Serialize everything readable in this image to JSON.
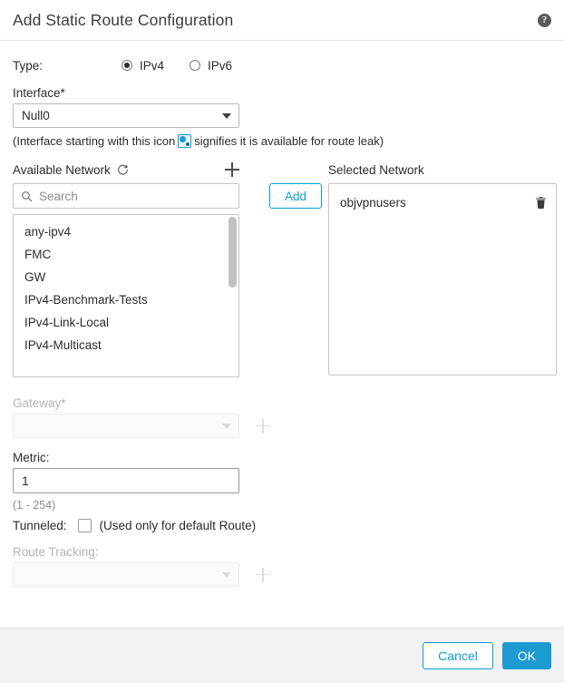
{
  "header": {
    "title": "Add Static Route Configuration",
    "help_icon": "help-circle-icon",
    "help_glyph": "?"
  },
  "form": {
    "type_label": "Type:",
    "type_options": [
      {
        "label": "IPv4",
        "selected": true
      },
      {
        "label": "IPv6",
        "selected": false
      }
    ],
    "interface_label": "Interface*",
    "interface_value": "Null0",
    "interface_hint_before": "(Interface starting with this icon",
    "interface_hint_after": "signifies it is available for route leak)",
    "route_leak_icon": "route-leak-icon",
    "gateway_label": "Gateway*",
    "gateway_value": "",
    "gateway_disabled": true,
    "metric_label": "Metric:",
    "metric_value": "1",
    "metric_hint": "(1 - 254)",
    "tunneled_label": "Tunneled:",
    "tunneled_checked": false,
    "tunneled_note": "(Used only for default Route)",
    "route_tracking_label": "Route Tracking:",
    "route_tracking_value": "",
    "route_tracking_disabled": true
  },
  "available_network": {
    "title": "Available Network",
    "refresh_icon": "refresh-icon",
    "add_object_icon": "plus-icon",
    "search_placeholder": "Search",
    "search_value": "",
    "search_icon": "search-icon",
    "items": [
      "any-ipv4",
      "FMC",
      "GW",
      "IPv4-Benchmark-Tests",
      "IPv4-Link-Local",
      "IPv4-Multicast"
    ]
  },
  "add_button": {
    "label": "Add"
  },
  "selected_network": {
    "title": "Selected Network",
    "items": [
      {
        "name": "objvpnusers",
        "delete_icon": "trash-icon"
      }
    ]
  },
  "footer": {
    "cancel_label": "Cancel",
    "ok_label": "OK"
  },
  "colors": {
    "accent": "#1d9bd1",
    "link": "#0d9bd4",
    "footer_bg": "#f2f2f2",
    "border": "#c4c4c4",
    "text": "#2b2b2b",
    "muted": "#8c8c8c",
    "disabled": "#b4b4b4"
  }
}
